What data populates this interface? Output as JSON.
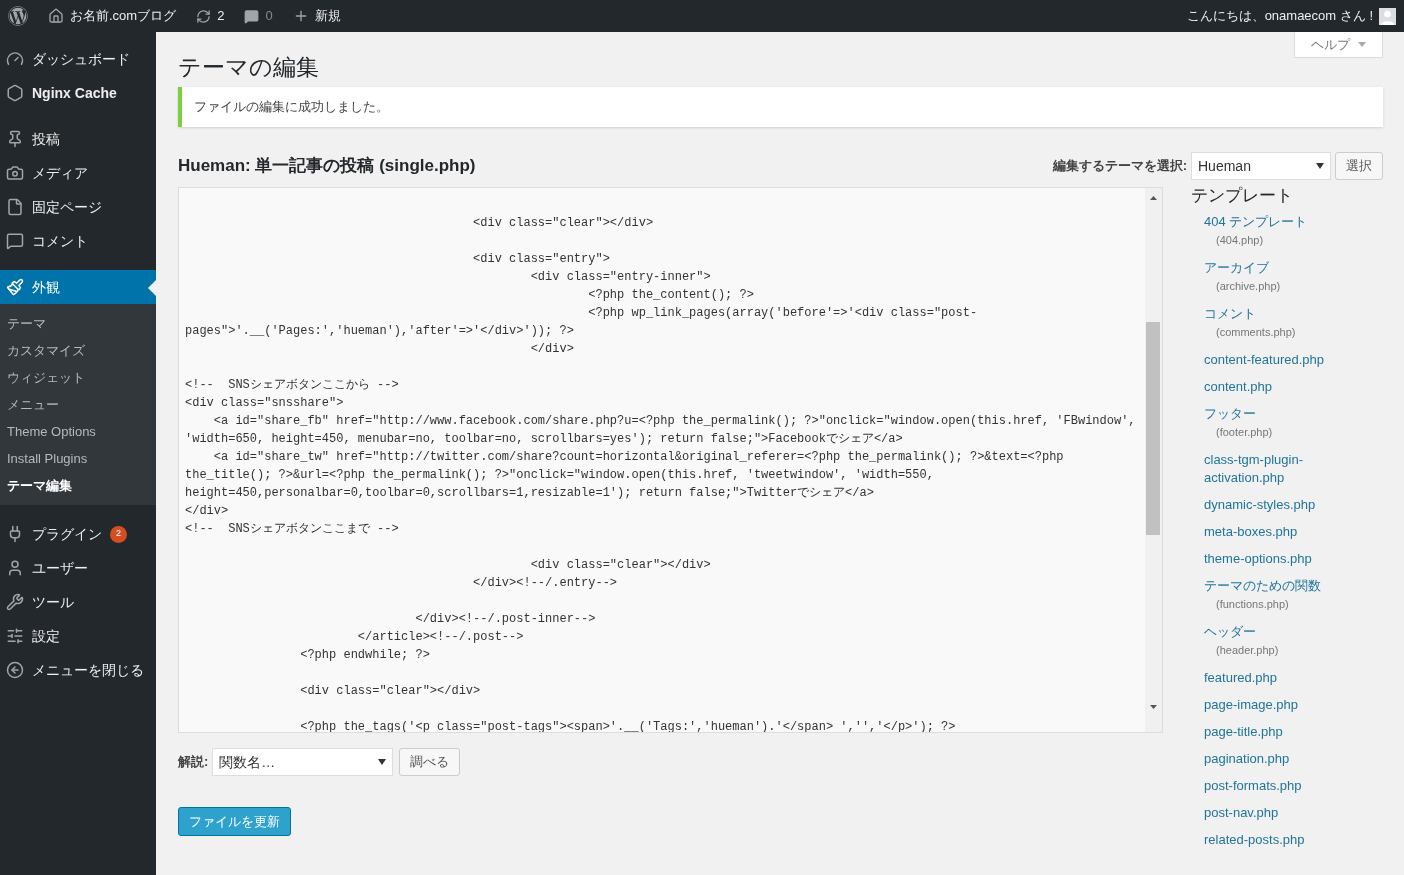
{
  "admin_bar": {
    "site_name": "お名前.comブログ",
    "updates": "2",
    "comments": "0",
    "new": "新規",
    "greeting": "こんにちは、onamaecom さん !"
  },
  "sidebar": {
    "items": [
      {
        "label": "ダッシュボード",
        "selected": false
      },
      {
        "label": "Nginx Cache",
        "selected": false
      },
      {
        "label": "投稿",
        "selected": false
      },
      {
        "label": "メディア",
        "selected": false
      },
      {
        "label": "固定ページ",
        "selected": false
      },
      {
        "label": "コメント",
        "selected": false
      },
      {
        "label": "外観",
        "selected": true,
        "children": [
          {
            "label": "テーマ",
            "selected": false
          },
          {
            "label": "カスタマイズ",
            "selected": false
          },
          {
            "label": "ウィジェット",
            "selected": false
          },
          {
            "label": "メニュー",
            "selected": false
          },
          {
            "label": "Theme Options",
            "selected": false
          },
          {
            "label": "Install Plugins",
            "selected": false
          },
          {
            "label": "テーマ編集",
            "selected": true
          }
        ]
      },
      {
        "label": "プラグイン",
        "selected": false,
        "badge": "2"
      },
      {
        "label": "ユーザー",
        "selected": false
      },
      {
        "label": "ツール",
        "selected": false
      },
      {
        "label": "設定",
        "selected": false
      },
      {
        "label": "メニューを閉じる",
        "selected": false
      }
    ]
  },
  "help_tab": "ヘルプ",
  "page_title": "テーマの編集",
  "notice": "ファイルの編集に成功しました。",
  "file_heading": "Hueman: 単一記事の投稿 (single.php)",
  "theme_select": {
    "label": "編集するテーマを選択:",
    "value": "Hueman",
    "button": "選択"
  },
  "code_blocks": [
    {
      "lines": [
        "                                        <div class=\"clear\"></div>"
      ]
    },
    {
      "lines": [
        "                                        <div class=\"entry\">",
        "                                                <div class=\"entry-inner\">",
        "                                                        <?php the_content(); ?>",
        "                                                        <?php wp_link_pages(array('before'=>'<div class=\"post-",
        "pages\">'.__('Pages:','hueman'),'after'=>'</div>')); ?>",
        "                                                </div>"
      ]
    },
    {
      "lines": [
        "<!--  SNSシェアボタンここから -->",
        "<div class=\"snsshare\">",
        "    <a id=\"share_fb\" href=\"http://www.facebook.com/share.php?u=<?php the_permalink(); ?>\"onclick=\"window.open(this.href, 'FBwindow',",
        "'width=650, height=450, menubar=no, toolbar=no, scrollbars=yes'); return false;\">Facebookでシェア</a>",
        "    <a id=\"share_tw\" href=\"http://twitter.com/share?count=horizontal&original_referer=<?php the_permalink(); ?>&text=<?php",
        "the_title(); ?>&url=<?php the_permalink(); ?>\"onclick=\"window.open(this.href, 'tweetwindow', 'width=550,",
        "height=450,personalbar=0,toolbar=0,scrollbars=1,resizable=1'); return false;\">Twitterでシェア</a>",
        "</div>",
        "<!--  SNSシェアボタンここまで -->"
      ]
    },
    {
      "lines": [
        "                                                <div class=\"clear\"></div>",
        "                                        </div><!--/.entry-->"
      ]
    },
    {
      "lines": [
        "                                </div><!--/.post-inner-->",
        "                        </article><!--/.post-->",
        "                <?php endwhile; ?>"
      ]
    },
    {
      "lines": [
        "                <div class=\"clear\"></div>"
      ]
    },
    {
      "lines": [
        "                <?php the_tags('<p class=\"post-tags\"><span>'.__('Tags:','hueman').'</span> ','','</p>'); ?>"
      ]
    }
  ],
  "lookup": {
    "label": "解説:",
    "placeholder": "関数名…",
    "button": "調べる"
  },
  "update_button": "ファイルを更新",
  "templates": {
    "title": "テンプレート",
    "files": [
      {
        "name": "404 テンプレート",
        "file": "(404.php)",
        "selected": false
      },
      {
        "name": "アーカイブ",
        "file": "(archive.php)",
        "selected": false
      },
      {
        "name": "コメント",
        "file": "(comments.php)",
        "selected": false
      },
      {
        "name": "content-featured.php",
        "selected": false
      },
      {
        "name": "content.php",
        "selected": false
      },
      {
        "name": "フッター",
        "file": "(footer.php)",
        "selected": false
      },
      {
        "name": "class-tgm-plugin-activation.php",
        "selected": false
      },
      {
        "name": "dynamic-styles.php",
        "selected": false
      },
      {
        "name": "meta-boxes.php",
        "selected": false
      },
      {
        "name": "theme-options.php",
        "selected": false
      },
      {
        "name": "テーマのための関数",
        "file": "(functions.php)",
        "selected": false
      },
      {
        "name": "ヘッダー",
        "file": "(header.php)",
        "selected": false
      },
      {
        "name": "featured.php",
        "selected": false
      },
      {
        "name": "page-image.php",
        "selected": false
      },
      {
        "name": "page-title.php",
        "selected": false
      },
      {
        "name": "pagination.php",
        "selected": false
      },
      {
        "name": "post-formats.php",
        "selected": false
      },
      {
        "name": "post-nav.php",
        "selected": false
      },
      {
        "name": "related-posts.php",
        "selected": false
      }
    ]
  }
}
